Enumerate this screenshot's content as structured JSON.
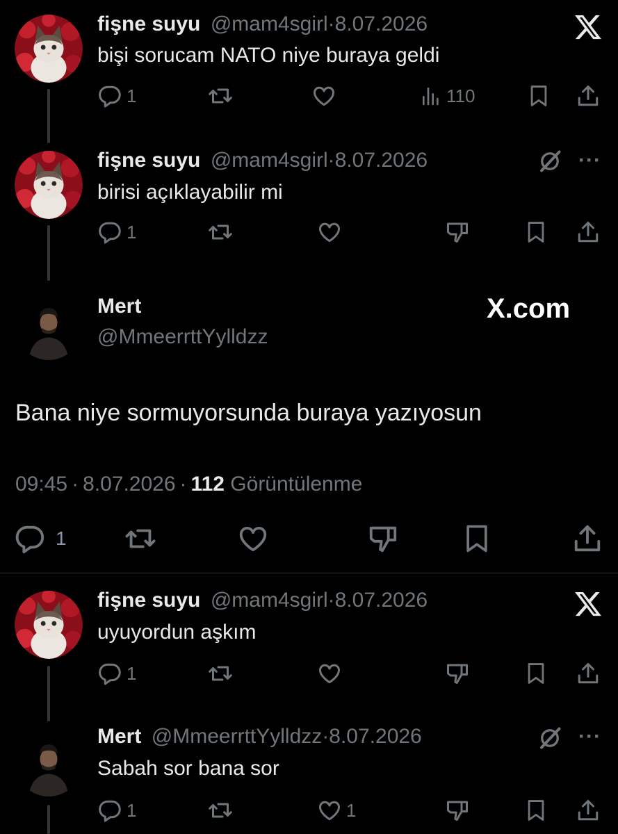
{
  "tweets": [
    {
      "name": "fişne suyu",
      "handle": "@mam4sgirl",
      "date": "8.07.2026",
      "text": "bişi sorucam NATO niye buraya geldi",
      "replies": "1",
      "views": "110"
    },
    {
      "name": "fişne suyu",
      "handle": "@mam4sgirl",
      "date": "8.07.2026",
      "text": "birisi açıklayabilir mi",
      "replies": "1"
    },
    {
      "name": "fişne suyu",
      "handle": "@mam4sgirl",
      "date": "8.07.2026",
      "text": "uyuyordun aşkım",
      "replies": "1"
    },
    {
      "name": "Mert",
      "handle": "@MmeerrttYylldzz",
      "date": "8.07.2026",
      "text": "Sabah sor bana sor",
      "replies": "1",
      "likes": "1"
    }
  ],
  "main": {
    "name": "Mert",
    "handle": "@MmeerrttYylldzz",
    "watermark": "X.com",
    "text": "Bana niye sormuyorsunda buraya yazıyosun",
    "time": "09:45",
    "date": "8.07.2026",
    "views": "112",
    "views_label": "Görüntülenme",
    "replies": "1"
  },
  "separator": "·",
  "icons": [
    "x-logo-icon",
    "reply-icon",
    "retweet-icon",
    "like-icon",
    "views-icon",
    "bookmark-icon",
    "share-icon",
    "grok-icon",
    "more-icon",
    "dislike-icon"
  ],
  "colors": {
    "background": "#000000",
    "text": "#e7e9ea",
    "secondary": "#71767b",
    "divider": "#2f3336"
  }
}
